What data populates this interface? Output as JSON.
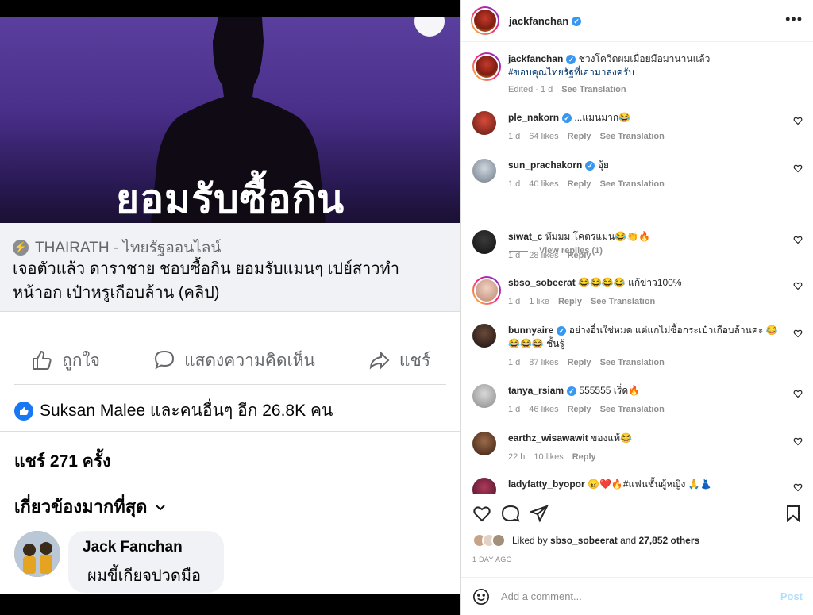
{
  "left": {
    "image_headline": "ยอมรับซื้อกิน",
    "link_card": {
      "source": "THAIRATH - ไทยรัฐออนไลน์",
      "title": "เจอตัวแล้ว ดาราชาย ชอบซื้อกิน ยอมรับแมนๆ เปย์สาวทำหน้าอก เป๋าหรูเกือบล้าน (คลิป)"
    },
    "actions": {
      "like": "ถูกใจ",
      "comment": "แสดงความคิดเห็น",
      "share": "แชร์"
    },
    "reactions": "Suksan Malee และคนอื่นๆ อีก 26.8K คน",
    "shares": "แชร์ 271 ครั้ง",
    "sort": "เกี่ยวข้องมากที่สุด",
    "top_comment": {
      "name": "Jack Fanchan",
      "text": "ผมขี้เกียจปวดมือ"
    }
  },
  "instagram": {
    "header_username": "jackfanchan",
    "caption": {
      "username": "jackfanchan",
      "text": "ช่วงโควิดผมเมื่อยมือมานานแล้ว",
      "hashtag": "#ขอบคุณไทยรัฐที่เอามาลงครับ",
      "edited": "Edited · 1 d",
      "see_translation": "See Translation"
    },
    "comments": [
      {
        "username": "ple_nakorn",
        "verified": true,
        "text": "...แมนมาก😂",
        "time": "1 d",
        "likes": "64 likes",
        "reply": "Reply",
        "translation": "See Translation"
      },
      {
        "username": "sun_prachakorn",
        "verified": true,
        "text": "อุ้ย",
        "time": "1 d",
        "likes": "40 likes",
        "reply": "Reply",
        "translation": "See Translation"
      },
      {
        "username": "siwat_c",
        "verified": false,
        "text": "หึมมม โคตรแมน😂👏🔥",
        "time": "1 d",
        "likes": "28 likes",
        "reply": "Reply",
        "translation": ""
      },
      {
        "username": "sbso_sobeerat",
        "verified": false,
        "text": "😂😂😂😂 แก้ข่าว100%",
        "time": "1 d",
        "likes": "1 like",
        "reply": "Reply",
        "translation": "See Translation"
      },
      {
        "username": "bunnyaire",
        "verified": true,
        "text": "อย่างอื่นใช่หมด แต่แกไม่ซื้อกระเป๋าเกือบล้านค่ะ 😂😂😂😂 ชั้นรู้",
        "time": "1 d",
        "likes": "87 likes",
        "reply": "Reply",
        "translation": "See Translation"
      },
      {
        "username": "tanya_rsiam",
        "verified": true,
        "text": "555555 เริ่ด🔥",
        "time": "1 d",
        "likes": "46 likes",
        "reply": "Reply",
        "translation": "See Translation"
      },
      {
        "username": "earthz_wisawawit",
        "verified": false,
        "text": "ของแท้😂",
        "time": "22 h",
        "likes": "10 likes",
        "reply": "Reply",
        "translation": ""
      },
      {
        "username": "ladyfatty_byopor",
        "verified": false,
        "text": "😠❤️🔥#แฟนชั้นผู้หญิง 🙏👗",
        "time": "",
        "likes": "",
        "reply": "",
        "translation": ""
      }
    ],
    "view_replies": "View replies (1)",
    "liked_by_prefix": "Liked by",
    "liked_by_user": "sbso_sobeerat",
    "liked_by_and": "and",
    "liked_by_others": "27,852 others",
    "date": "1 DAY AGO",
    "add_comment_placeholder": "Add a comment...",
    "post_button": "Post"
  },
  "colors": {
    "ig_link": "#00376b",
    "fb_blue": "#1877f2",
    "post_disabled": "#b2dffc"
  }
}
